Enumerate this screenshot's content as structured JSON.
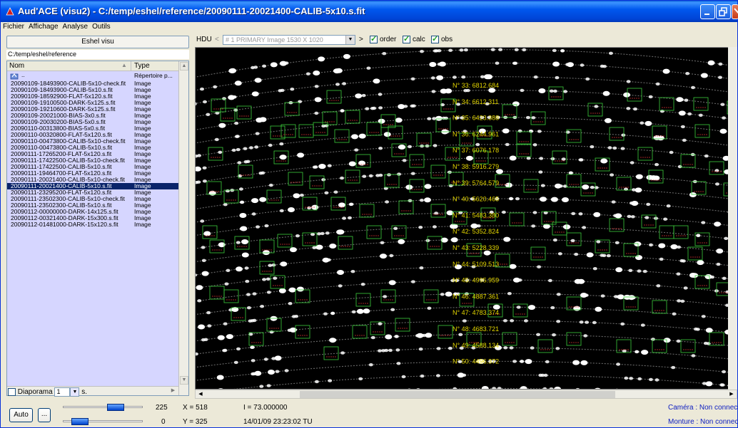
{
  "window": {
    "title": "Aud'ACE (visu2) - C:/temp/eshel/reference/20090111-20021400-CALIB-5x10.s.fit"
  },
  "menu": [
    "Fichier",
    "Affichage",
    "Analyse",
    "Outils"
  ],
  "left_panel": {
    "eshel_button": "Eshel visu",
    "path": "C:/temp/eshel/reference",
    "columns": {
      "name": "Nom",
      "type": "Type"
    },
    "parent_row": {
      "name": "..",
      "type": "Répertoire p..."
    },
    "files": [
      {
        "name": "20090109-18493900-CALIB-5x10-check.fit",
        "type": "Image"
      },
      {
        "name": "20090109-18493900-CALIB-5x10.s.fit",
        "type": "Image"
      },
      {
        "name": "20090109-18592900-FLAT-5x120.s.fit",
        "type": "Image"
      },
      {
        "name": "20090109-19100500-DARK-5x125.s.fit",
        "type": "Image"
      },
      {
        "name": "20090109-19210600-DARK-5x125.s.fit",
        "type": "Image"
      },
      {
        "name": "20090109-20021000-BIAS-3x0.s.fit",
        "type": "Image"
      },
      {
        "name": "20090109-20030200-BIAS-5x0.s.fit",
        "type": "Image"
      },
      {
        "name": "20090110-00313800-BIAS-5x0.s.fit",
        "type": "Image"
      },
      {
        "name": "20090110-00320800-FLAT-5x120.s.fit",
        "type": "Image"
      },
      {
        "name": "20090110-00473800-CALIB-5x10-check.fit",
        "type": "Image"
      },
      {
        "name": "20090110-00473800-CALIB-5x10.s.fit",
        "type": "Image"
      },
      {
        "name": "20090111-17265200-FLAT-5x120.s.fit",
        "type": "Image"
      },
      {
        "name": "20090111-17422500-CALIB-5x10-check.fit",
        "type": "Image"
      },
      {
        "name": "20090111-17422500-CALIB-5x10.s.fit",
        "type": "Image"
      },
      {
        "name": "20090111-19464700-FLAT-5x120.s.fit",
        "type": "Image"
      },
      {
        "name": "20090111-20021400-CALIB-5x10-check.fit",
        "type": "Image"
      },
      {
        "name": "20090111-20021400-CALIB-5x10.s.fit",
        "type": "Image",
        "selected": true
      },
      {
        "name": "20090111-23295200-FLAT-5x120.s.fit",
        "type": "Image"
      },
      {
        "name": "20090111-23502300-CALIB-5x10-check.fit",
        "type": "Image"
      },
      {
        "name": "20090111-23502300-CALIB-5x10.s.fit",
        "type": "Image"
      },
      {
        "name": "20090112-00000000-DARK-14x125.s.fit",
        "type": "Image"
      },
      {
        "name": "20090112-00321400-DARK-15x300.s.fit",
        "type": "Image"
      },
      {
        "name": "20090112-01481000-DARK-15x120.s.fit",
        "type": "Image"
      }
    ],
    "diaporama": {
      "label": "Diaporama",
      "value": "1",
      "unit": "s.",
      "checked": false
    }
  },
  "hdu_bar": {
    "label": "HDU",
    "prev": "<",
    "next": ">",
    "combo_value": "# 1   PRIMARY   Image  1530 X 1020",
    "checkboxes": [
      {
        "label": "order",
        "checked": true
      },
      {
        "label": "calc",
        "checked": true
      },
      {
        "label": "obs",
        "checked": true
      }
    ]
  },
  "orders": [
    "N° 33: 6812.684",
    "N° 34: 6612.311",
    "N° 35: 6423.388",
    "N° 36: 6244.961",
    "N° 37: 6076.178",
    "N° 38: 5916.279",
    "N° 39: 5764.579",
    "N° 40: 5620.465",
    "N° 41: 5483.380",
    "N° 42: 5352.824",
    "N° 43: 5228.339",
    "N° 44: 5109.513",
    "N° 45: 4995.959",
    "N° 46: 4887.361",
    "N° 47: 4783.374",
    "N° 48: 4683.721",
    "N° 49: 4588.134",
    "N° 50: 4496.372"
  ],
  "status": {
    "auto_button": "Auto",
    "dots_button": "...",
    "slider_high": "225",
    "slider_low": "0",
    "x": "X = 518",
    "y": "Y = 325",
    "intensity": "I = 73.000000",
    "datetime": "14/01/09 23:23:02 TU",
    "camera": "Caméra  : Non connecté",
    "mount": "Monture  : Non connecté"
  },
  "colors": {
    "title_bar": "#0058ee",
    "list_bg": "#d6d6ff",
    "selection": "#0a246a",
    "order_label": "#e6d800",
    "box": "#3ccc3c",
    "status_blue": "#1020c0"
  }
}
